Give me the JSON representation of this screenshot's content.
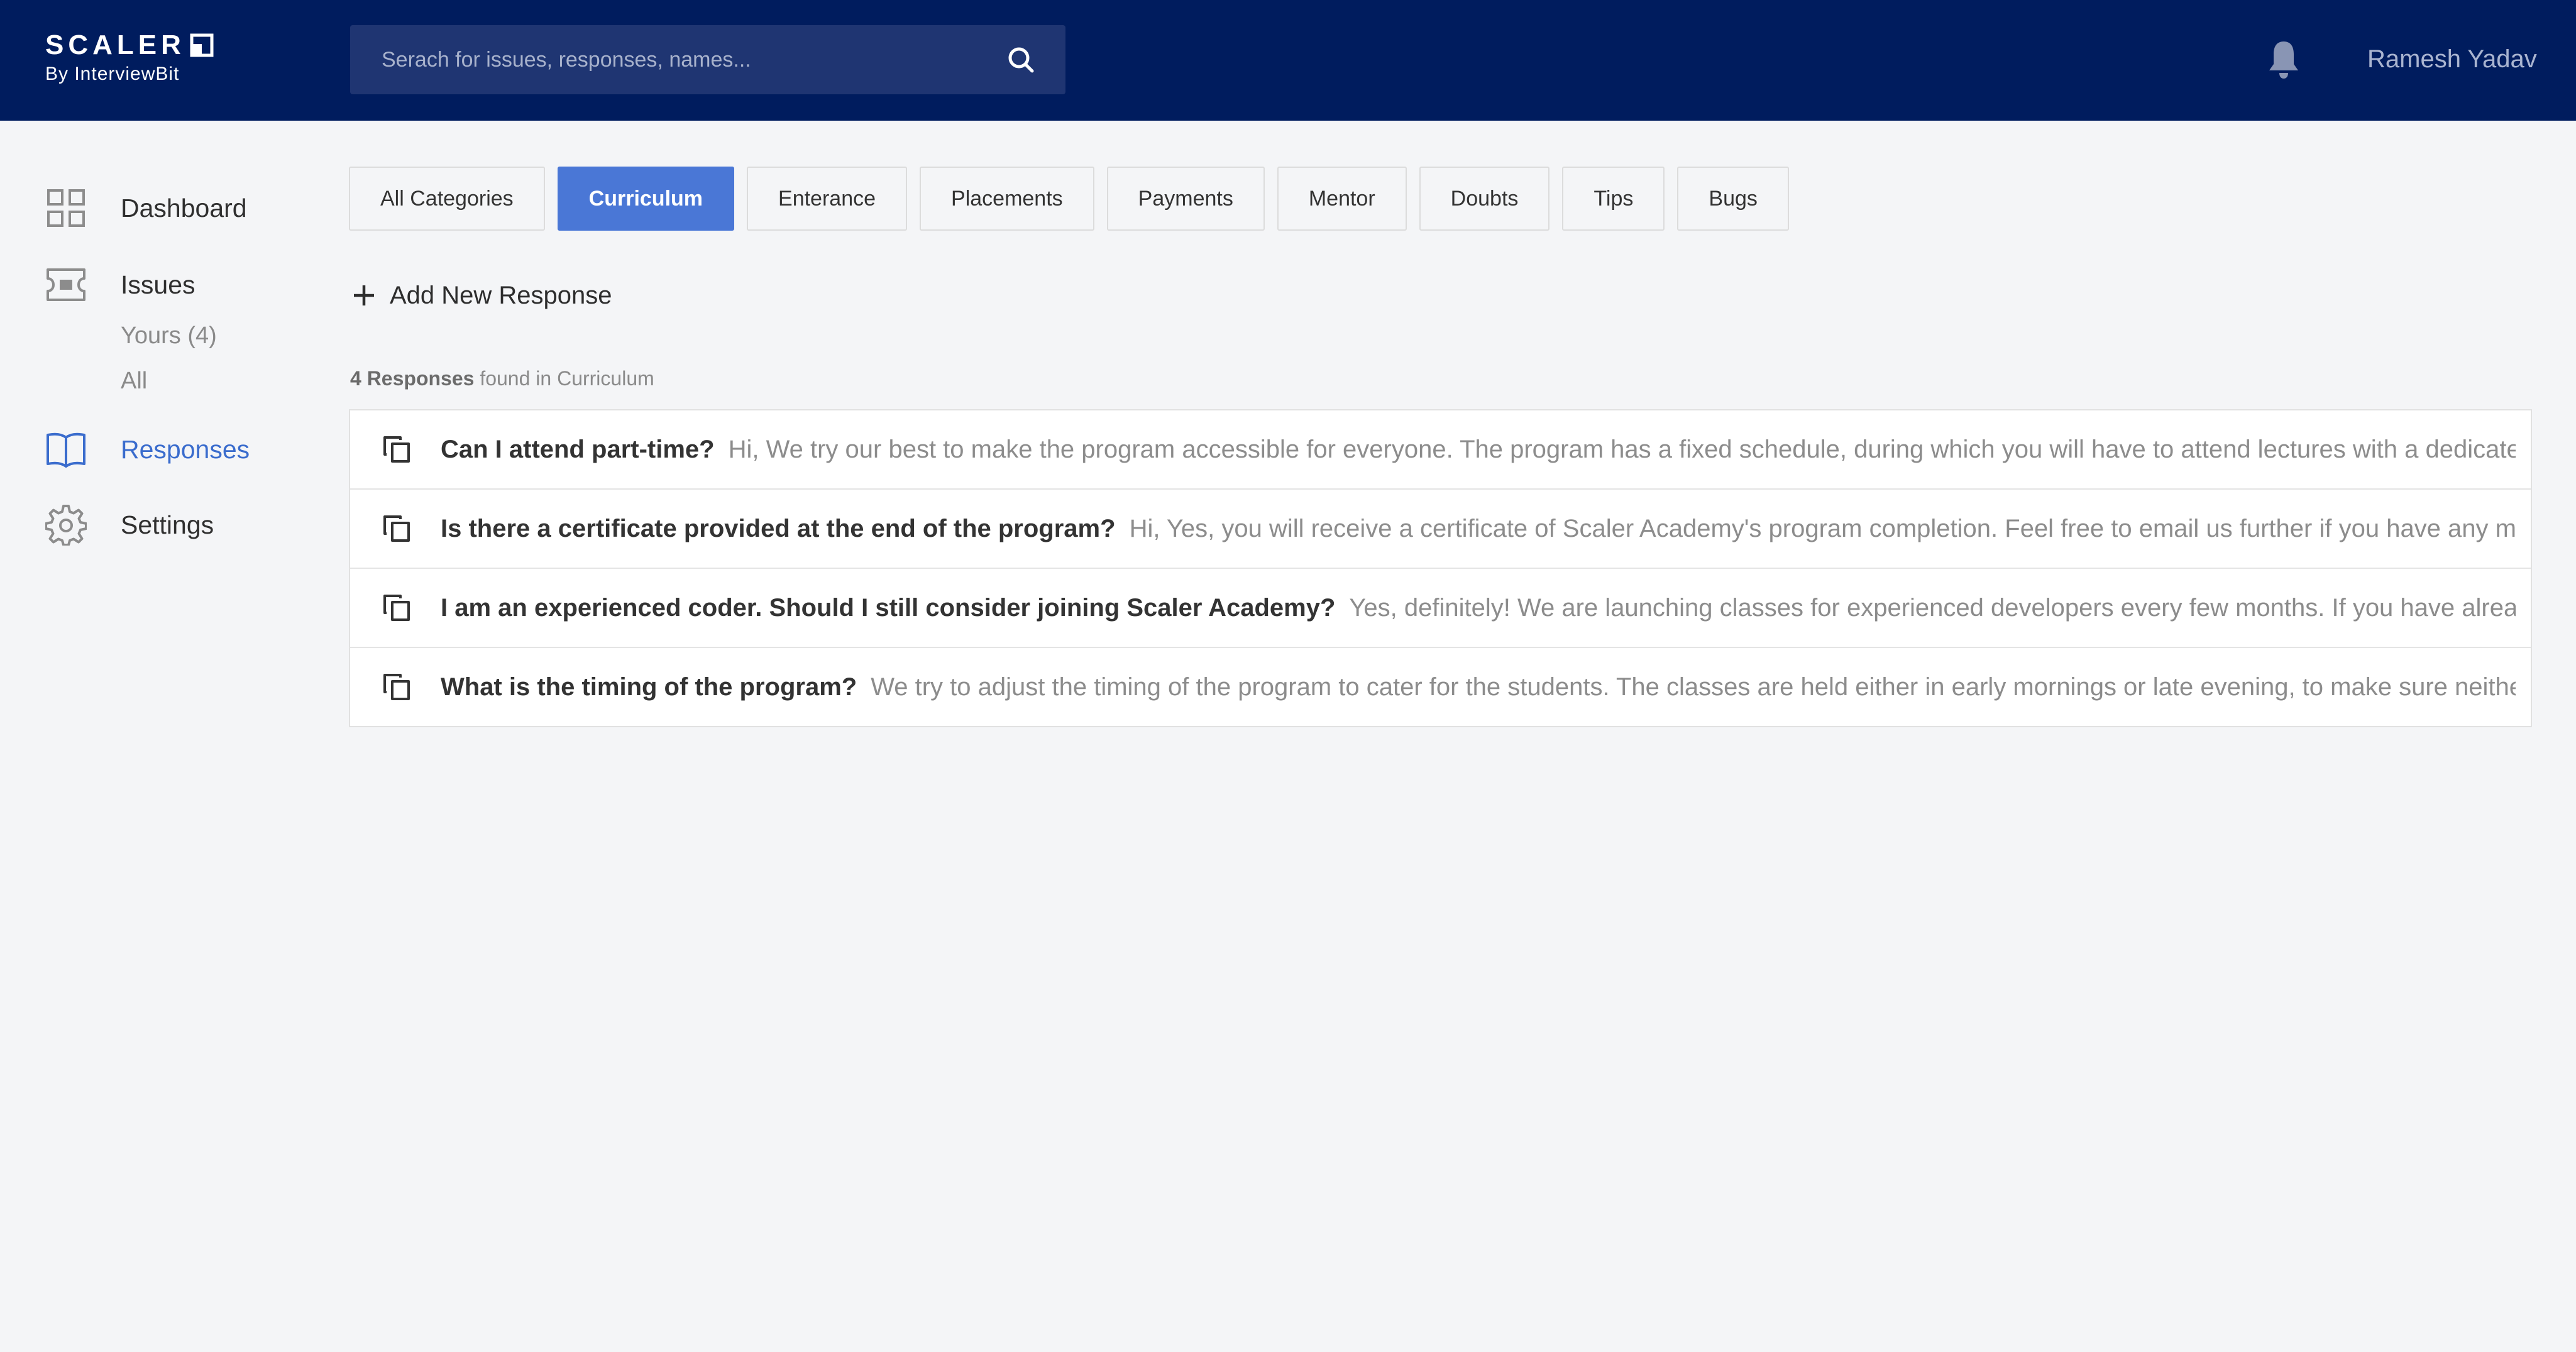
{
  "brand": {
    "name": "SCALER",
    "tagline": "By InterviewBit"
  },
  "search": {
    "placeholder": "Serach for issues, responses, names..."
  },
  "user": {
    "name": "Ramesh Yadav"
  },
  "sidebar": {
    "items": [
      {
        "label": "Dashboard",
        "icon": "grid-icon"
      },
      {
        "label": "Issues",
        "icon": "ticket-icon",
        "sub": [
          "Yours (4)",
          "All"
        ]
      },
      {
        "label": "Responses",
        "icon": "book-icon",
        "active": true
      },
      {
        "label": "Settings",
        "icon": "gear-icon"
      }
    ]
  },
  "categories": {
    "tabs": [
      "All Categories",
      "Curriculum",
      "Enterance",
      "Placements",
      "Payments",
      "Mentor",
      "Doubts",
      "Tips",
      "Bugs"
    ],
    "selected": "Curriculum"
  },
  "actions": {
    "add_new": "Add New Response"
  },
  "results": {
    "count_label": "4 Responses",
    "suffix": "found in Curriculum"
  },
  "responses": [
    {
      "title": "Can I attend part-time?",
      "body": "Hi, We try our best to make the program accessible for everyone. The program has a fixed schedule, during which you will have to attend lectures with a dedicated"
    },
    {
      "title": "Is there a certificate provided at the end of the program?",
      "body": "Hi, Yes, you will receive a certificate of Scaler Academy's program completion.  Feel free to email us further if you have any more qu"
    },
    {
      "title": "I am an experienced coder. Should I still consider joining Scaler Academy?",
      "body": "Yes, definitely! We are launching classes for experienced developers every few months. If you have already applie"
    },
    {
      "title": "What is the timing of the program?",
      "body": "We try to adjust the timing of the program to cater for the students. The classes are held either in early mornings or late evening, to make sure neither you"
    }
  ],
  "colors": {
    "header_bg": "#001c5e",
    "search_bg": "#1f3572",
    "accent": "#4a77d6",
    "active_text": "#3a6ccd",
    "page_bg": "#f4f5f7"
  }
}
